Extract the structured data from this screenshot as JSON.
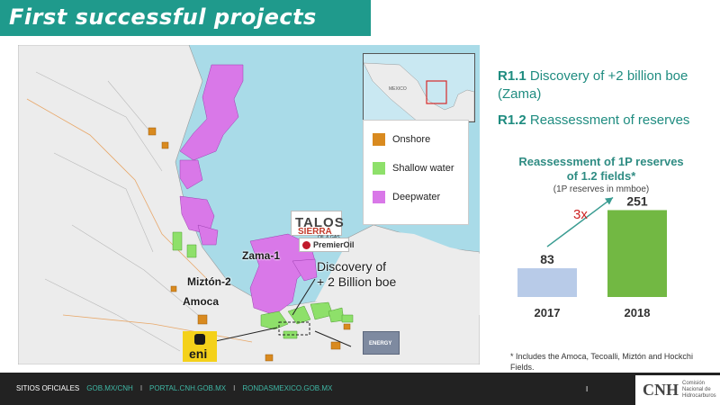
{
  "title": "First successful projects",
  "legend": {
    "items": [
      {
        "label": "Onshore",
        "color": "#d98a1f"
      },
      {
        "label": "Shallow water",
        "color": "#8ee06a"
      },
      {
        "label": "Deepwater",
        "color": "#d978e8"
      }
    ]
  },
  "map": {
    "inset_label": "MEXICO",
    "labels": {
      "zama": "Zama-1",
      "mizton": "Miztón-2",
      "amoca": "Amoca",
      "discovery_line1": "Discovery of",
      "discovery_line2": "+ 2 Billion boe"
    },
    "logos": {
      "talos": "TALOS",
      "sierra": "SIERRA",
      "sierra_sub": "OIL & GAS",
      "premier": "PremierOil",
      "eni": "eni",
      "fieldwood": "ENERGY"
    },
    "colors": {
      "water": "#a9dbe8",
      "land": "#ececec",
      "onshore": "#d98a1f",
      "shallow": "#8ee06a",
      "deep": "#d978e8"
    }
  },
  "results": {
    "r1_1_code": "R1.1",
    "r1_1_text": " Discovery of +2 billion boe",
    "r1_1_text2": "(Zama)",
    "r1_2_code": "R1.2",
    "r1_2_text": " Reassessment of reserves"
  },
  "chart_data": {
    "type": "bar",
    "title": "Reassessment of 1P reserves of 1.2 fields*",
    "title_line1": "Reassessment of 1P reserves",
    "title_line2": "of 1.2 fields*",
    "subtitle": "(1P reserves in mmboe)",
    "categories": [
      "2017",
      "2018"
    ],
    "values": [
      83,
      251
    ],
    "colors": [
      "#b8cbe8",
      "#72b843"
    ],
    "annotation": "3x",
    "annotation_color": "#cc2222",
    "arrow_color": "#3a9c92",
    "ylim": [
      0,
      260
    ]
  },
  "footnote": "* Includes the Amoca, Tecoalli, Miztón and Hockchi Fields.",
  "footer": {
    "label": "SITIOS OFICIALES",
    "link1": "GOB.MX/CNH",
    "link2": "PORTAL.CNH.GOB.MX",
    "link3": "RONDASMEXICO.GOB.MX",
    "sep": "I",
    "page": "I",
    "cnh_abbr": "CNH",
    "cnh_full": "Comisión Nacional de Hidrocarburos"
  }
}
